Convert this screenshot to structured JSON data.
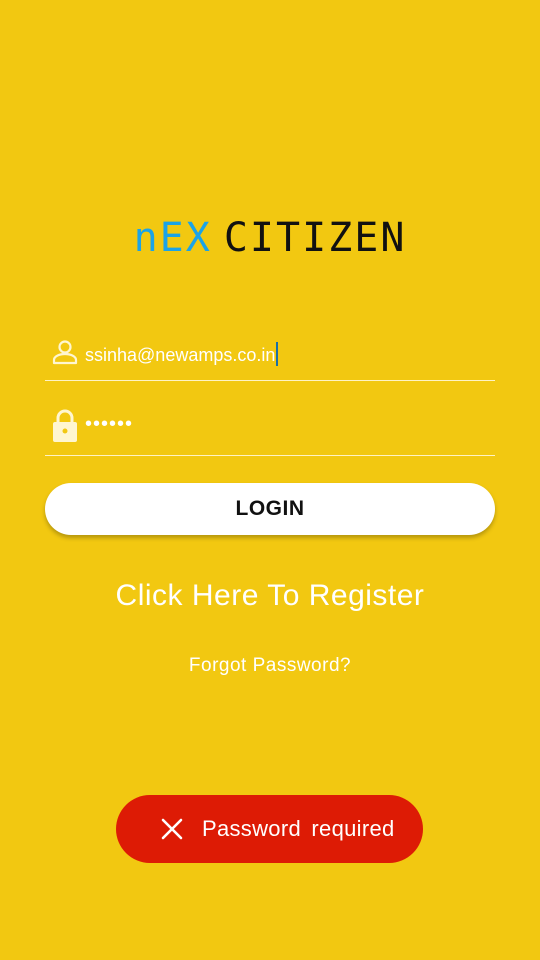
{
  "logo": {
    "part1": "nEX",
    "part2": "CITIZEN"
  },
  "email_field": {
    "value": "ssinha@newamps.co.in",
    "icon": "user-icon"
  },
  "password_field": {
    "value": "••••••",
    "icon": "lock-icon"
  },
  "login_button": {
    "label": "LOGIN"
  },
  "register_link": {
    "label": "Click Here To Register"
  },
  "forgot_link": {
    "label": "Forgot Password?"
  },
  "toast": {
    "message": "Password required",
    "icon": "close-icon"
  },
  "colors": {
    "background": "#F2C811",
    "logo_accent": "#1BA3E8",
    "toast_background": "#DD1B05"
  }
}
